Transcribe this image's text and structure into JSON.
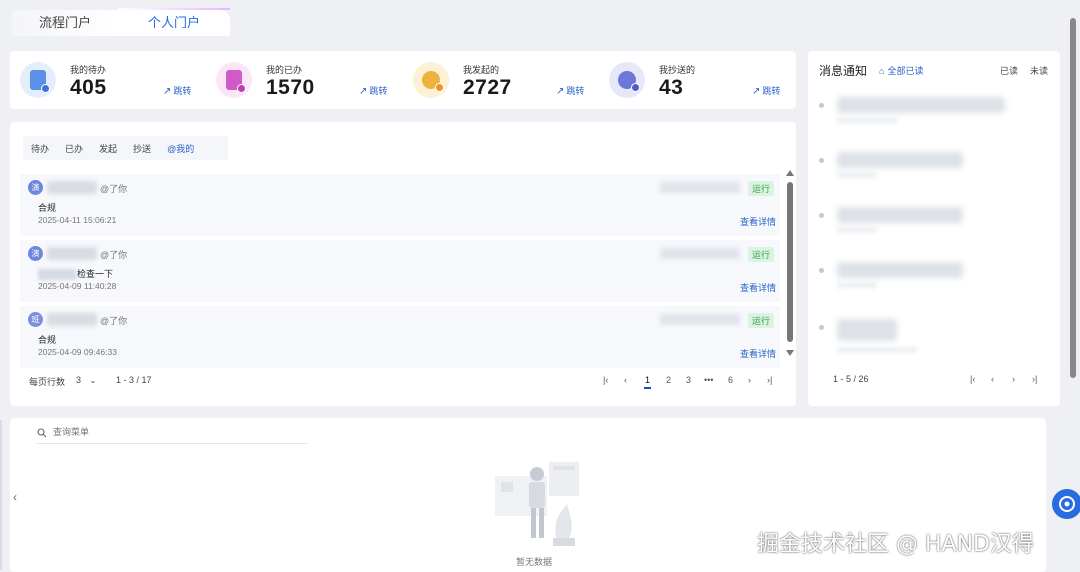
{
  "tabs": [
    {
      "label": "流程门户"
    },
    {
      "label": "个人门户"
    }
  ],
  "stats": [
    {
      "label": "我的待办",
      "value": "405",
      "link": "跳转",
      "icon": "todo-doc-icon",
      "color": "#5b8fe8"
    },
    {
      "label": "我的已办",
      "value": "1570",
      "link": "跳转",
      "icon": "done-doc-icon",
      "color": "#d25ac8"
    },
    {
      "label": "我发起的",
      "value": "2727",
      "link": "跳转",
      "icon": "initiated-user-icon",
      "color": "#f0b23c"
    },
    {
      "label": "我抄送的",
      "value": "43",
      "link": "跳转",
      "icon": "cc-user-icon",
      "color": "#6c78d8"
    }
  ],
  "filters": [
    "待办",
    "已办",
    "发起",
    "抄送",
    "@我的"
  ],
  "messages": [
    {
      "avatar": "演",
      "mention": "@了你",
      "status": "运行",
      "title": "合规",
      "time": "2025-04-11 15:06:21",
      "detail": "查看详情"
    },
    {
      "avatar": "演",
      "mention": "@了你",
      "status": "运行",
      "title": "检查一下",
      "time": "2025-04-09 11:40:28",
      "detail": "查看详情"
    },
    {
      "avatar": "班",
      "mention": "@了你",
      "status": "运行",
      "title": "合规",
      "time": "2025-04-09 09:46:33",
      "detail": "查看详情"
    }
  ],
  "pagination": {
    "rows_label": "每页行数",
    "rows_value": "3",
    "range": "1 - 3 / 17",
    "pages": [
      "1",
      "2",
      "3",
      "•••",
      "6"
    ],
    "current": "1"
  },
  "notice": {
    "title": "消息通知",
    "mark_all": "全部已读",
    "read": "已读",
    "unread": "未读",
    "range": "1 - 5 / 26"
  },
  "bottom": {
    "search_placeholder": "查询菜单",
    "empty": "暂无数据"
  },
  "watermark": "掘金技术社区 @ HAND汉得",
  "colors": {
    "accent": "#2a62c9",
    "status_green": "#2ca34c"
  }
}
